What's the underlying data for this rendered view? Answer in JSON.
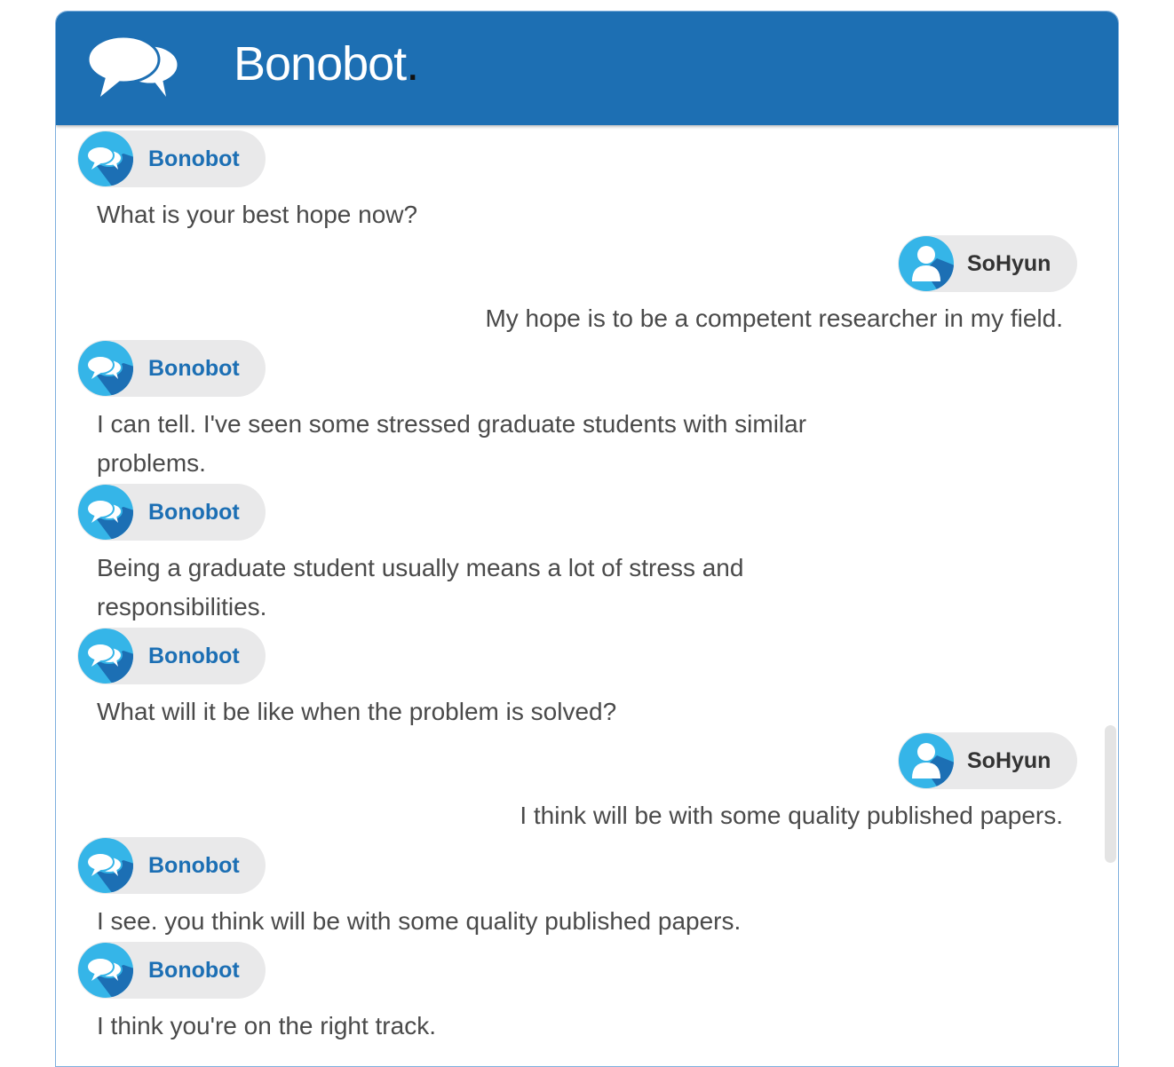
{
  "app": {
    "title": "Bonobot",
    "title_dot": ".",
    "header_color": "#1d6fb3",
    "logo_icon": "speech-bubbles-icon"
  },
  "conversation": {
    "messages": [
      {
        "sender": "Bonobot",
        "role": "bot",
        "text": "What is your best hope now?"
      },
      {
        "sender": "SoHyun",
        "role": "user",
        "text": "My hope is to be a competent researcher in my field."
      },
      {
        "sender": "Bonobot",
        "role": "bot",
        "text": "I can tell. I've seen some stressed graduate students with similar problems."
      },
      {
        "sender": "Bonobot",
        "role": "bot",
        "text": "Being a graduate student usually means a lot of stress and responsibilities."
      },
      {
        "sender": "Bonobot",
        "role": "bot",
        "text": "What will it be like when the problem is solved?"
      },
      {
        "sender": "SoHyun",
        "role": "user",
        "text": "I think will be with some quality published papers."
      },
      {
        "sender": "Bonobot",
        "role": "bot",
        "text": "I see. you think will be with some quality published papers."
      },
      {
        "sender": "Bonobot",
        "role": "bot",
        "text": "I think you're on the right track."
      }
    ]
  },
  "colors": {
    "bot_name": "#1c6fb4",
    "user_name": "#333333",
    "avatar_light": "#35b5e8",
    "avatar_dark": "#1c6fb4"
  }
}
